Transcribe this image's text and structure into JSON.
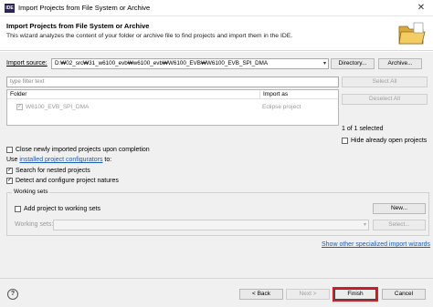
{
  "window": {
    "app_icon": "IDE",
    "title": "Import Projects from File System or Archive",
    "close_glyph": "✕"
  },
  "header": {
    "title": "Import Projects from File System or Archive",
    "description": "This wizard analyzes the content of your folder or archive file to find projects and import them in the IDE."
  },
  "source": {
    "label": "Import source:",
    "value": "D:₩02_src₩31_w6100_evb₩w6100_evb₩W6100_EVB₩W6100_EVB_SPI_DMA",
    "directory_button": "Directory...",
    "archive_button": "Archive..."
  },
  "filter": {
    "placeholder": "type filter text",
    "select_all": "Select All",
    "deselect_all": "Deselect All"
  },
  "table": {
    "columns": [
      "Folder",
      "Import as"
    ],
    "rows": [
      {
        "folder": "W6100_EVB_SPI_DMA",
        "import_as": "Eclipse project",
        "checked": true
      }
    ]
  },
  "selection": {
    "count_text": "1 of 1 selected",
    "hide_open_label": "Hide already open projects"
  },
  "options": {
    "close_newly": "Close newly imported projects upon completion",
    "use_prefix": "Use",
    "installed_link": "installed project configurators",
    "use_suffix": "to:",
    "search_nested": "Search for nested projects",
    "detect_natures": "Detect and configure project natures"
  },
  "working_sets": {
    "group_label": "Working sets",
    "add_label": "Add project to working sets",
    "new_button": "New...",
    "sets_label": "Working sets:",
    "select_button": "Select..."
  },
  "specialized_link": "Show other specialized import wizards",
  "footer": {
    "help": "?",
    "back": "< Back",
    "next": "Next >",
    "finish": "Finish",
    "cancel": "Cancel"
  },
  "colors": {
    "link": "#1a5bbf",
    "highlight": "#d0202a",
    "background": "#f0f0f0"
  }
}
